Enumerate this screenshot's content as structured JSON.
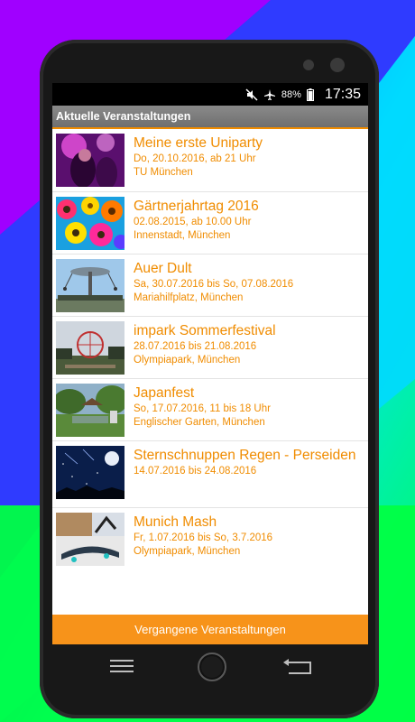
{
  "status": {
    "battery": "88%",
    "time": "17:35",
    "icons": [
      "mute-icon",
      "airplane-icon",
      "battery-icon"
    ]
  },
  "header": {
    "title": "Aktuelle Veranstaltungen"
  },
  "events": [
    {
      "title": "Meine erste Uniparty",
      "line1": "Do, 20.10.2016, ab 21 Uhr",
      "line2": "TU München",
      "image": "party-image"
    },
    {
      "title": "Gärtnerjahrtag 2016",
      "line1": "02.08.2015, ab 10.00 Uhr",
      "line2": "Innenstadt, München",
      "image": "flowers-image"
    },
    {
      "title": "Auer Dult",
      "line1": "Sa, 30.07.2016 bis So, 07.08.2016",
      "line2": "Mariahilfplatz, München",
      "image": "carousel-image"
    },
    {
      "title": "impark Sommerfestival",
      "line1": "28.07.2016 bis 21.08.2016",
      "line2": "Olympiapark, München",
      "image": "ferris-wheel-image"
    },
    {
      "title": "Japanfest",
      "line1": "So, 17.07.2016, 11 bis 18 Uhr",
      "line2": "Englischer Garten, München",
      "image": "garden-image"
    },
    {
      "title": "Sternschnuppen Regen - Perseiden",
      "line1": "14.07.2016 bis 24.08.2016",
      "line2": "",
      "image": "night-sky-image"
    },
    {
      "title": "Munich Mash",
      "line1": "Fr, 1.07.2016 bis So, 3.7.2016",
      "line2": "Olympiapark, München",
      "image": "skate-image"
    }
  ],
  "footer": {
    "button_label": "Vergangene Veranstaltungen"
  },
  "colors": {
    "accent": "#f08c00",
    "button": "#f7931a",
    "titlebar": "#7a7a7a"
  }
}
